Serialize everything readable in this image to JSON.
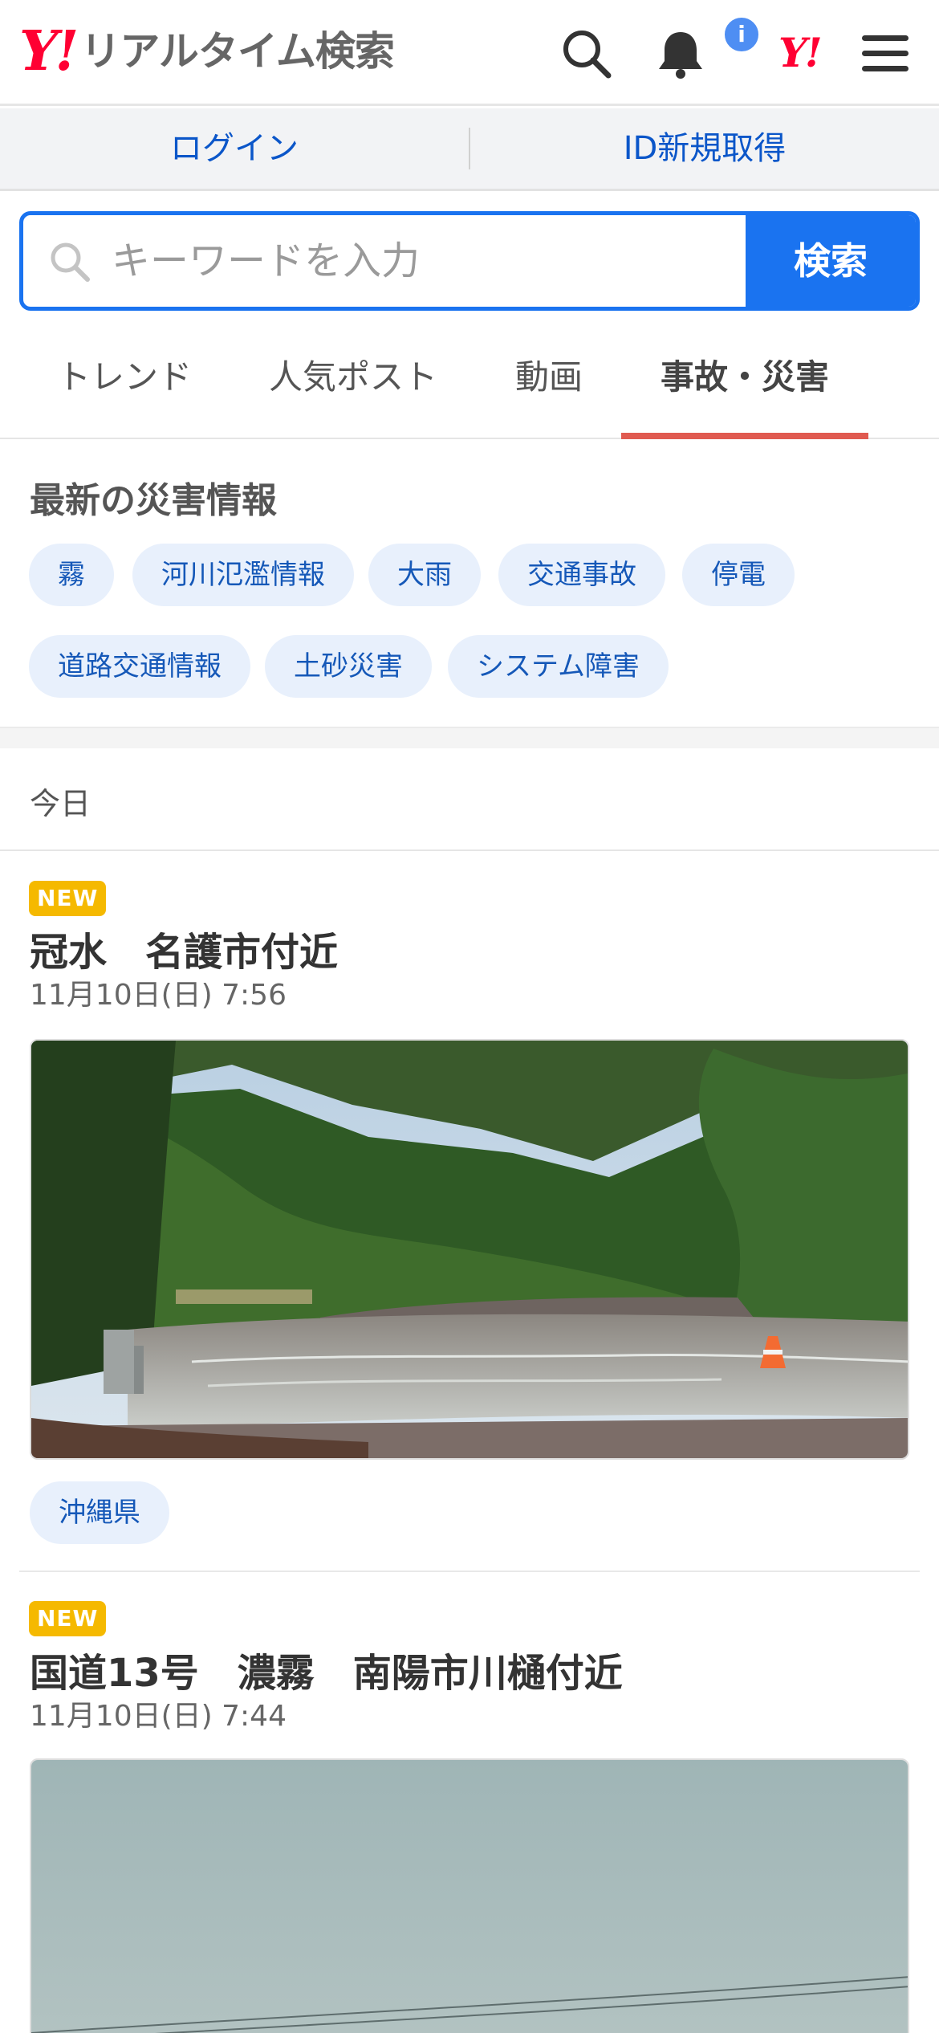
{
  "header": {
    "logo_mark": "Y!",
    "logo_text": "リアルタイム検索",
    "notification_badge": "i",
    "yahoo_mark": "Y!",
    "icons": [
      "search-icon",
      "bell-icon",
      "yahoo-logo-icon",
      "menu-icon"
    ]
  },
  "loginbar": {
    "login": "ログイン",
    "signup": "ID新規取得"
  },
  "search": {
    "placeholder": "キーワードを入力",
    "button": "検索"
  },
  "tabs": [
    {
      "label": "トレンド",
      "active": false
    },
    {
      "label": "人気ポスト",
      "active": false
    },
    {
      "label": "動画",
      "active": false
    },
    {
      "label": "事故・災害",
      "active": true
    }
  ],
  "disaster": {
    "heading": "最新の災害情報",
    "chips": [
      "霧",
      "河川氾濫情報",
      "大雨",
      "交通事故",
      "停電",
      "道路交通情報",
      "土砂災害",
      "システム障害"
    ]
  },
  "today_label": "今日",
  "articles": [
    {
      "badge": "NEW",
      "title": "冠水　名護市付近",
      "time": "11月10日(日) 7:56",
      "location": "沖縄県"
    },
    {
      "badge": "NEW",
      "title": "国道13号　濃霧　南陽市川樋付近",
      "time": "11月10日(日) 7:44"
    }
  ],
  "colors": {
    "brand_red": "#ff0033",
    "accent_blue": "#1a73f0",
    "tab_underline": "#e05a50",
    "new_badge": "#f5b900",
    "chip_bg": "#e8f0fc"
  }
}
